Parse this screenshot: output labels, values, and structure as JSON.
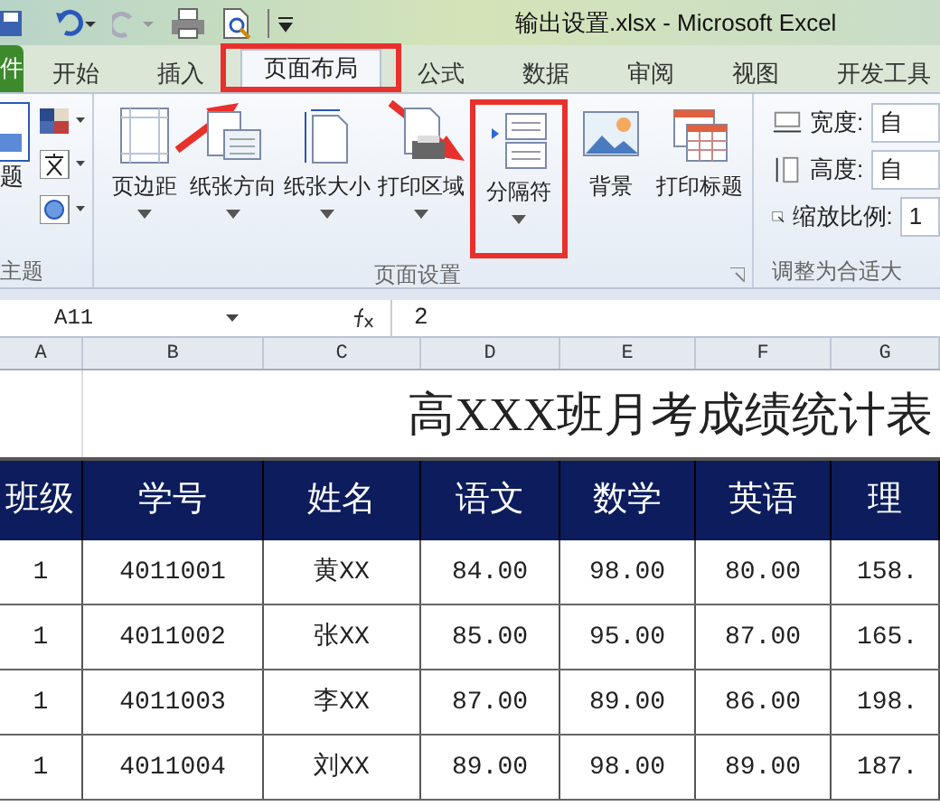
{
  "window": {
    "title": "输出设置.xlsx  -  Microsoft Excel"
  },
  "tabs": [
    {
      "label": "件",
      "kind": "file",
      "selected": false
    },
    {
      "label": "开始",
      "kind": "tab",
      "selected": false
    },
    {
      "label": "插入",
      "kind": "tab",
      "selected": false
    },
    {
      "label": "页面布局",
      "kind": "tab",
      "selected": true,
      "highlighted": true
    },
    {
      "label": "公式",
      "kind": "tab",
      "selected": false
    },
    {
      "label": "数据",
      "kind": "tab",
      "selected": false
    },
    {
      "label": "审阅",
      "kind": "tab",
      "selected": false
    },
    {
      "label": "视图",
      "kind": "tab",
      "selected": false
    },
    {
      "label": "开发工具",
      "kind": "tab",
      "selected": false
    }
  ],
  "ribbon": {
    "themes_group": {
      "button_label": "题",
      "label": "主题"
    },
    "page_setup_group": {
      "label": "页面设置",
      "buttons": [
        {
          "label": "页边距",
          "kind": "margins",
          "dropdown": true
        },
        {
          "label": "纸张方向",
          "kind": "orientation",
          "dropdown": true
        },
        {
          "label": "纸张大小",
          "kind": "size",
          "dropdown": true
        },
        {
          "label": "打印区域",
          "kind": "area",
          "dropdown": true
        },
        {
          "label": "分隔符",
          "kind": "breaks",
          "dropdown": true,
          "highlighted": true
        },
        {
          "label": "背景",
          "kind": "background",
          "dropdown": false
        },
        {
          "label": "打印标题",
          "kind": "titles",
          "dropdown": false
        }
      ]
    },
    "scale_group": {
      "label": "调整为合适大",
      "fields": [
        {
          "label": "宽度:",
          "kind": "width",
          "value": "自"
        },
        {
          "label": "高度:",
          "kind": "height",
          "value": "自"
        },
        {
          "label": "缩放比例:",
          "kind": "scale",
          "value": "1"
        }
      ]
    }
  },
  "formula_bar": {
    "name_box": "A11",
    "formula": "2"
  },
  "columns": [
    "A",
    "B",
    "C",
    "D",
    "E",
    "F",
    "G"
  ],
  "sheet": {
    "title": "高XXX班月考成绩统计表",
    "header": [
      "班级",
      "学号",
      "姓名",
      "语文",
      "数学",
      "英语",
      "理"
    ],
    "rows": [
      [
        "1",
        "4011001",
        "黄XX",
        "84.00",
        "98.00",
        "80.00",
        "158."
      ],
      [
        "1",
        "4011002",
        "张XX",
        "85.00",
        "95.00",
        "87.00",
        "165."
      ],
      [
        "1",
        "4011003",
        "李XX",
        "87.00",
        "89.00",
        "86.00",
        "198."
      ],
      [
        "1",
        "4011004",
        "刘XX",
        "89.00",
        "98.00",
        "89.00",
        "187."
      ]
    ]
  }
}
